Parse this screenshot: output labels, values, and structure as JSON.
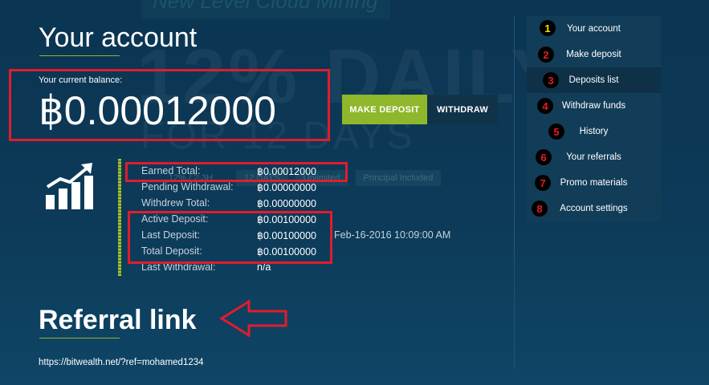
{
  "background": {
    "banner_text": "New Level Cloud Mining",
    "promo_big": "12% DAILY",
    "promo_sub": "FOR 12 DAYS",
    "tags": [
      "12% / 2-3H",
      "12 DAYS",
      "Unlimited",
      "Principal Included"
    ]
  },
  "account": {
    "title": "Your account",
    "balance_label": "Your current balance:",
    "balance_value": "฿0.00012000",
    "make_deposit_label": "MAKE DEPOSIT",
    "withdraw_label": "WITHDRAW"
  },
  "stats": [
    {
      "label": "Earned Total:",
      "value": "฿0.00012000",
      "extra": ""
    },
    {
      "label": "Pending Withdrawal:",
      "value": "฿0.00000000",
      "extra": ""
    },
    {
      "label": "Withdrew Total:",
      "value": "฿0.00000000",
      "extra": ""
    },
    {
      "label": "Active Deposit:",
      "value": "฿0.00100000",
      "extra": ""
    },
    {
      "label": "Last Deposit:",
      "value": "฿0.00100000",
      "extra": "Feb-16-2016 10:09:00 AM"
    },
    {
      "label": "Total Deposit:",
      "value": "฿0.00100000",
      "extra": ""
    },
    {
      "label": "Last Withdrawal:",
      "value": "n/a",
      "extra": ""
    }
  ],
  "referral": {
    "title": "Referral link",
    "url": "https://bitwealth.net/?ref=mohamed1234"
  },
  "menu": [
    {
      "num": "1",
      "label": "Your account"
    },
    {
      "num": "2",
      "label": "Make deposit"
    },
    {
      "num": "3",
      "label": "Deposits list"
    },
    {
      "num": "4",
      "label": "Withdraw funds"
    },
    {
      "num": "5",
      "label": "History"
    },
    {
      "num": "6",
      "label": "Your referrals"
    },
    {
      "num": "7",
      "label": "Promo materials"
    },
    {
      "num": "8",
      "label": "Account settings"
    }
  ],
  "colors": {
    "accent_green": "#8fb72b",
    "annotation_red": "#e21c2c",
    "background": "#0c3a58"
  }
}
